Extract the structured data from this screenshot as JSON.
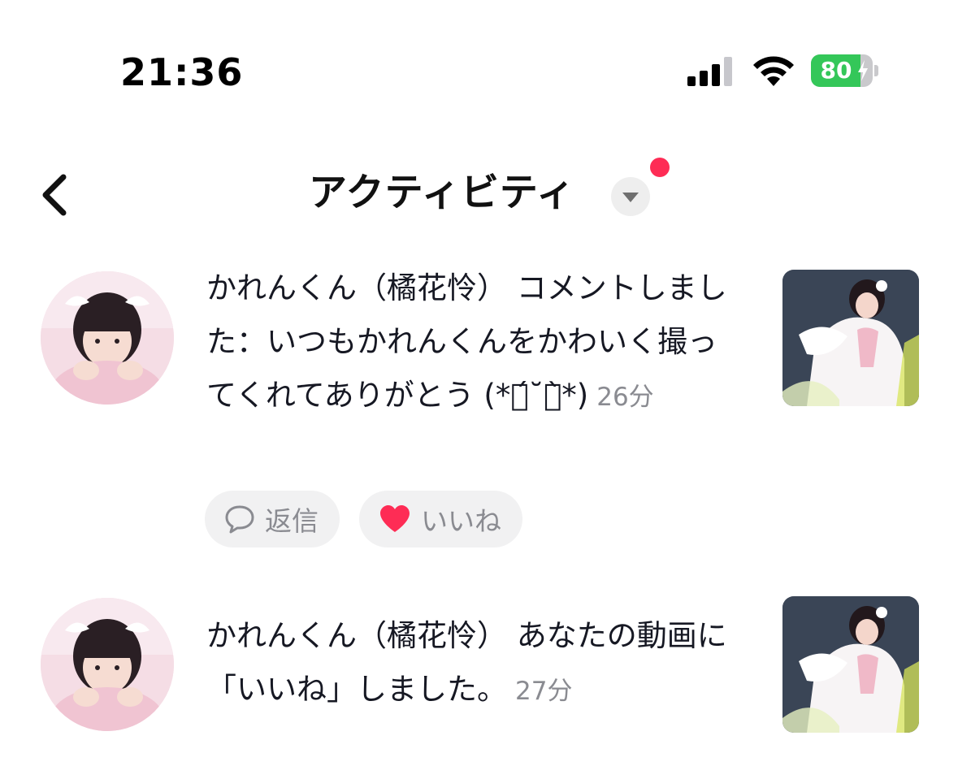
{
  "status_bar": {
    "time": "21:36",
    "battery_percent": "80",
    "battery_level": 0.8,
    "charging": true,
    "signal_icon": "cellular-signal-icon",
    "wifi_icon": "wifi-icon"
  },
  "header": {
    "title": "アクティビティ",
    "back_icon": "chevron-left-icon",
    "dropdown_icon": "caret-down-icon",
    "has_notification_dot": true
  },
  "colors": {
    "accent_red": "#fe2c55",
    "battery_green": "#34c759",
    "secondary_text": "#8a8b91",
    "pill_bg": "#f1f1f2"
  },
  "activities": [
    {
      "type": "comment",
      "text": "かれんくん（橘花怜） コメントしました：いつもかれんくんをかわいく撮ってくれてありがとう (*ต́˘ต̀*)",
      "time_ago": "26分",
      "actions": {
        "reply_label": "返信",
        "like_label": "いいね"
      }
    },
    {
      "type": "like",
      "text": "かれんくん（橘花怜） あなたの動画に「いいね」しました。",
      "time_ago": "27分"
    }
  ]
}
